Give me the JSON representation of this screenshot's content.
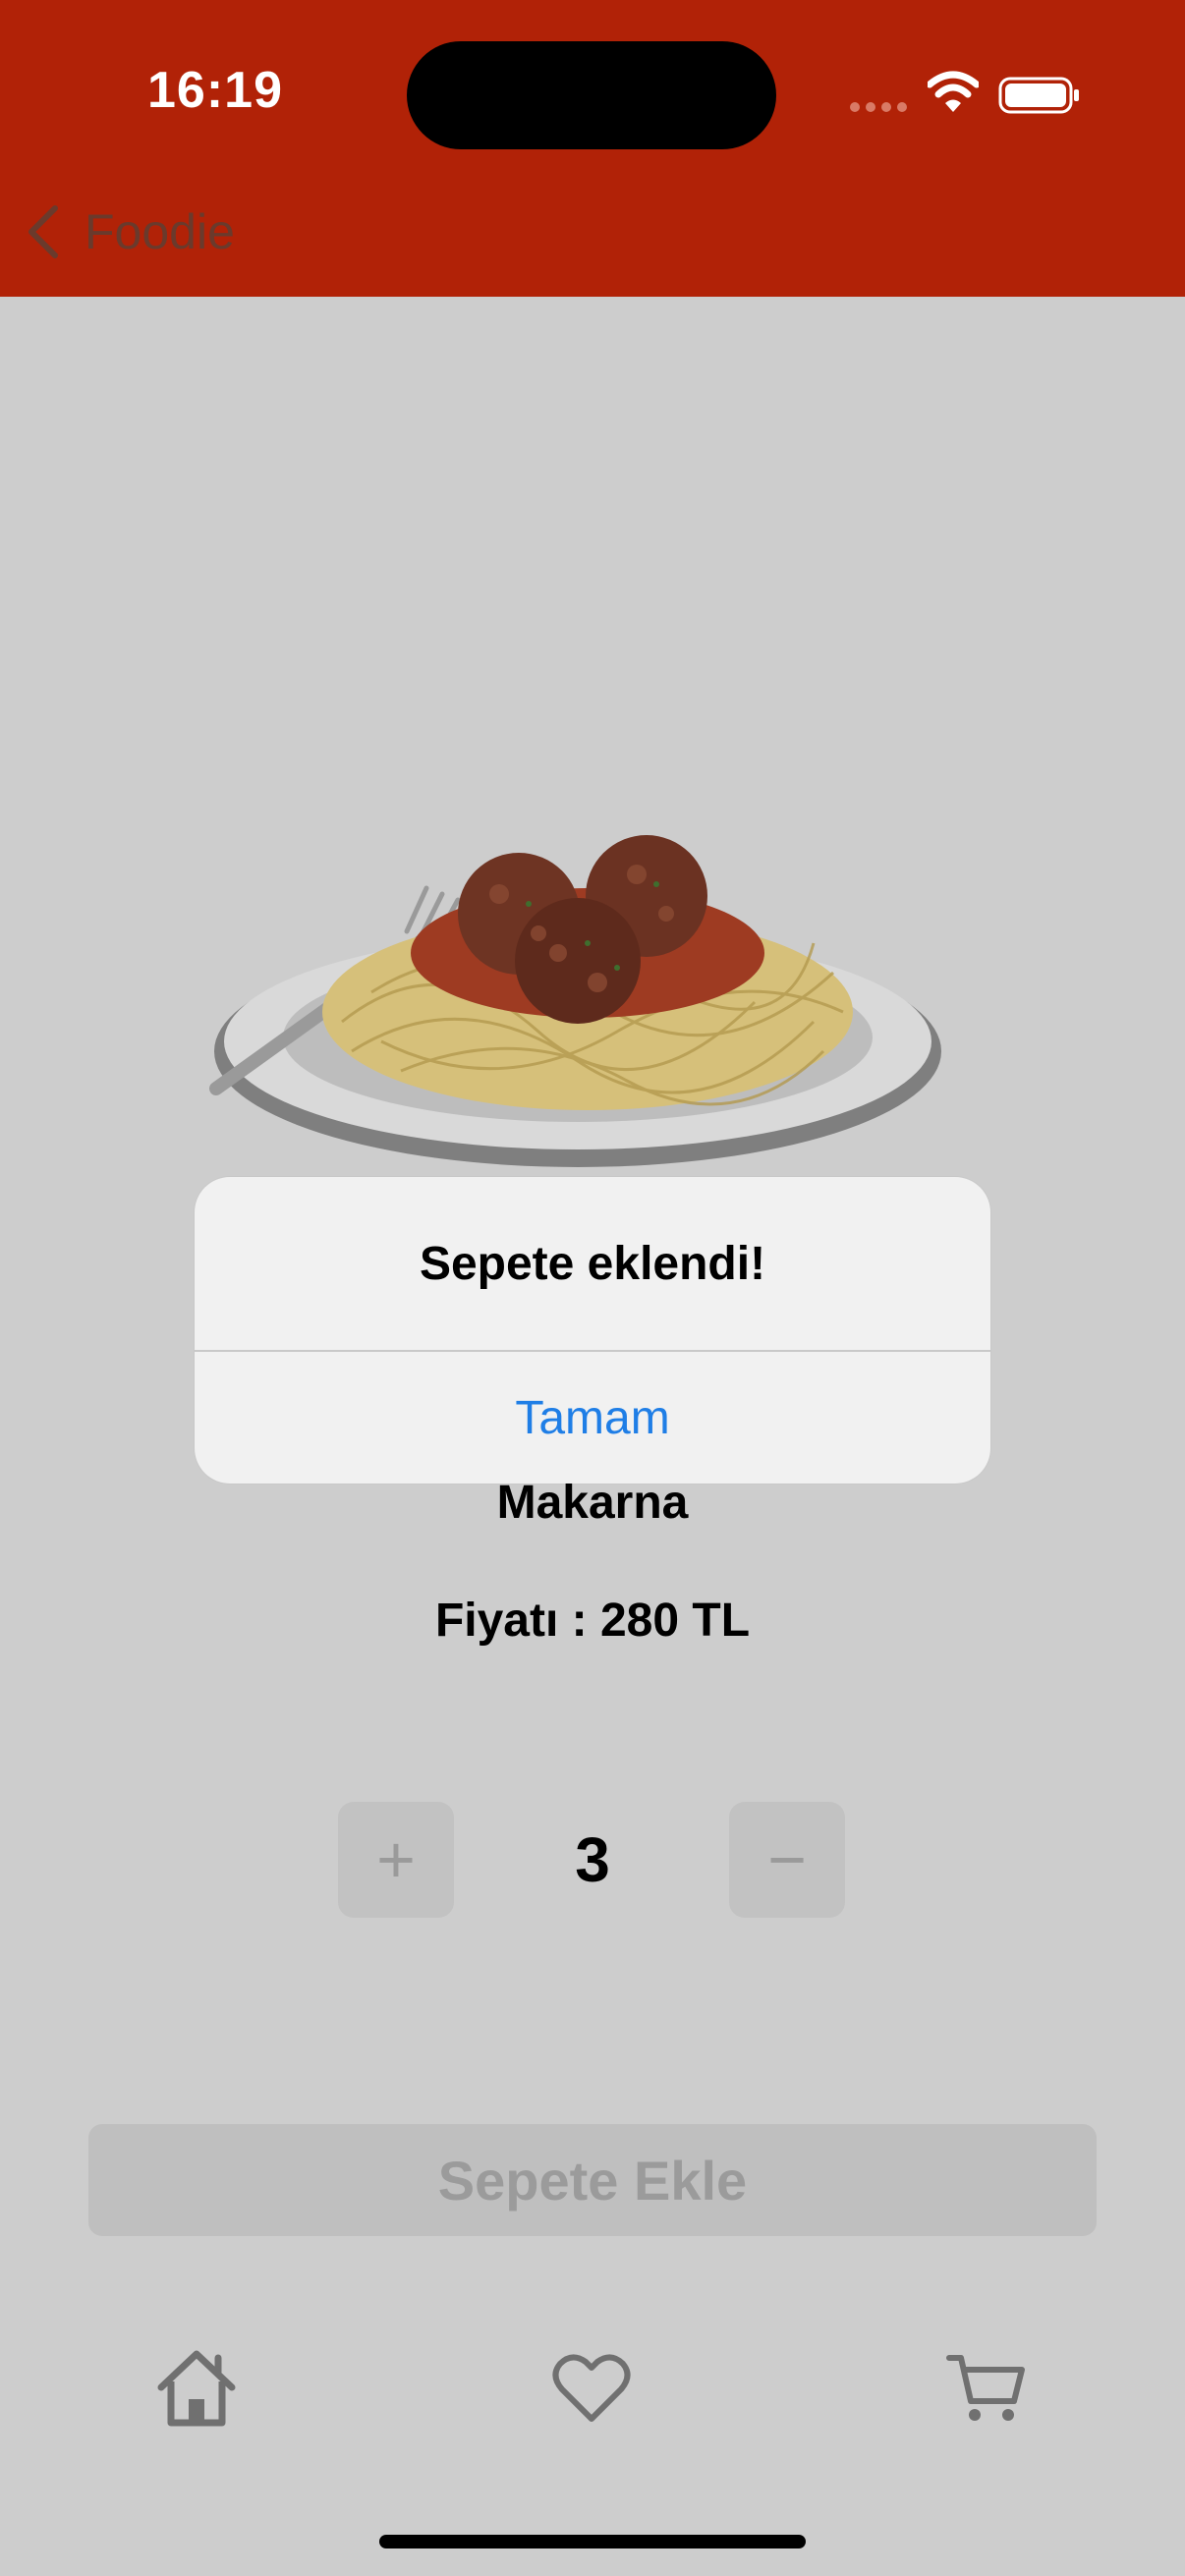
{
  "status_bar": {
    "time": "16:19"
  },
  "nav": {
    "back_label": "Foodie"
  },
  "product": {
    "name": "Makarna",
    "price_text": "Fiyatı : 280 TL",
    "image_icon": "spaghetti-plate-image"
  },
  "stepper": {
    "plus_label": "+",
    "minus_label": "−",
    "quantity": "3"
  },
  "actions": {
    "add_to_cart_label": "Sepete Ekle"
  },
  "tabs": [
    {
      "icon": "home-icon"
    },
    {
      "icon": "heart-icon"
    },
    {
      "icon": "cart-icon"
    }
  ],
  "alert": {
    "title": "Sepete eklendi!",
    "button_label": "Tamam"
  },
  "colors": {
    "brand_red": "#b12207",
    "alert_button_blue": "#1f7ee6",
    "dimmed_background": "#cdcdcd"
  }
}
